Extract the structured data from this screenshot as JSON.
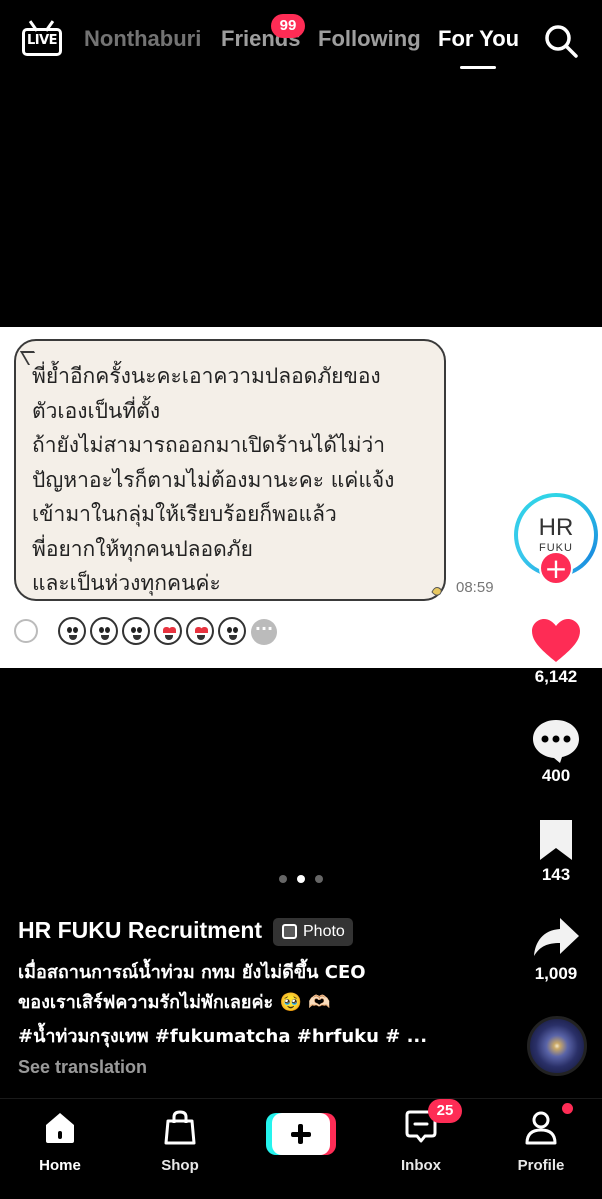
{
  "top_nav": {
    "live_label": "LIVE",
    "tabs": [
      {
        "label": "Nonthaburi"
      },
      {
        "label": "Friends"
      },
      {
        "label": "Following"
      },
      {
        "label": "For You"
      }
    ],
    "friends_badge": "99",
    "active_tab": "For You"
  },
  "chat_image": {
    "message_lines": [
      "พี่ย้ำอีกครั้งนะคะเอาความปลอดภัยของ",
      "ตัวเองเป็นที่ตั้ง",
      "ถ้ายังไม่สามารถออกมาเปิดร้านได้ไม่ว่า",
      "ปัญหาอะไรก็ตามไม่ต้องมานะคะ แค่แจ้ง",
      "เข้ามาในกลุ่มให้เรียบร้อยก็พอแล้ว",
      "พี่อยากให้ทุกคนปลอดภัย",
      "และเป็นห่วงทุกคนค่ะ"
    ],
    "time": "08:59"
  },
  "right_rail": {
    "avatar_text_top": "HR",
    "avatar_text_bottom": "FUKU",
    "likes": "6,142",
    "comments": "400",
    "saves": "143",
    "shares": "1,009",
    "colors": {
      "like": "#fe2c55",
      "follow": "#fe2c55",
      "ring": "#2fd5e6"
    }
  },
  "caption": {
    "author": "HR FUKU Recruitment",
    "content_type": "Photo",
    "line1": "เมื่อสถานการณ์น้ำท่วม กทม ยังไม่ดีขึ้น CEO",
    "line2": "ของเราเสิร์ฟความรักไม่พักเลยค่ะ 🥹 🫶🏻",
    "line3": "#น้ำท่วมกรุงเทพ #fukumatcha #hrfuku # ...",
    "see_translation": "See translation"
  },
  "carousel": {
    "total": 3,
    "active_index": 1
  },
  "bottom_nav": {
    "items": [
      {
        "label": "Home",
        "icon": "home-icon"
      },
      {
        "label": "Shop",
        "icon": "shop-bag-icon"
      },
      {
        "label": "",
        "icon": "create-plus-icon"
      },
      {
        "label": "Inbox",
        "icon": "inbox-icon"
      },
      {
        "label": "Profile",
        "icon": "profile-icon"
      }
    ],
    "inbox_badge": "25"
  }
}
